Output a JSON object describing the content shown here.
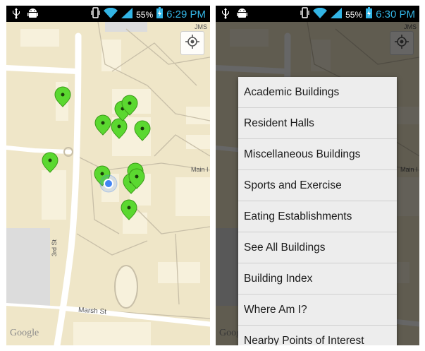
{
  "status_bar": {
    "battery_percent": "55%",
    "left_time": "6:29 PM",
    "right_time": "6:30 PM",
    "icons": [
      "usb-icon",
      "android-debug-icon",
      "vibrate-icon",
      "wifi-icon",
      "signal-icon",
      "battery-charging-icon"
    ]
  },
  "map": {
    "labels": {
      "top_right": "JMS",
      "main": "Main I",
      "third": "3rd St",
      "marsh": "Marsh St"
    },
    "logo": "Google",
    "pins": 12,
    "accent_pin_color": "#5bd830",
    "location_dot_color": "#4285f4"
  },
  "menu": {
    "items": [
      "Academic Buildings",
      "Resident Halls",
      "Miscellaneous Buildings",
      "Sports and Exercise",
      "Eating Establishments",
      "See All Buildings",
      "Building Index",
      "Where Am I?",
      "Nearby Points of Interest"
    ]
  }
}
